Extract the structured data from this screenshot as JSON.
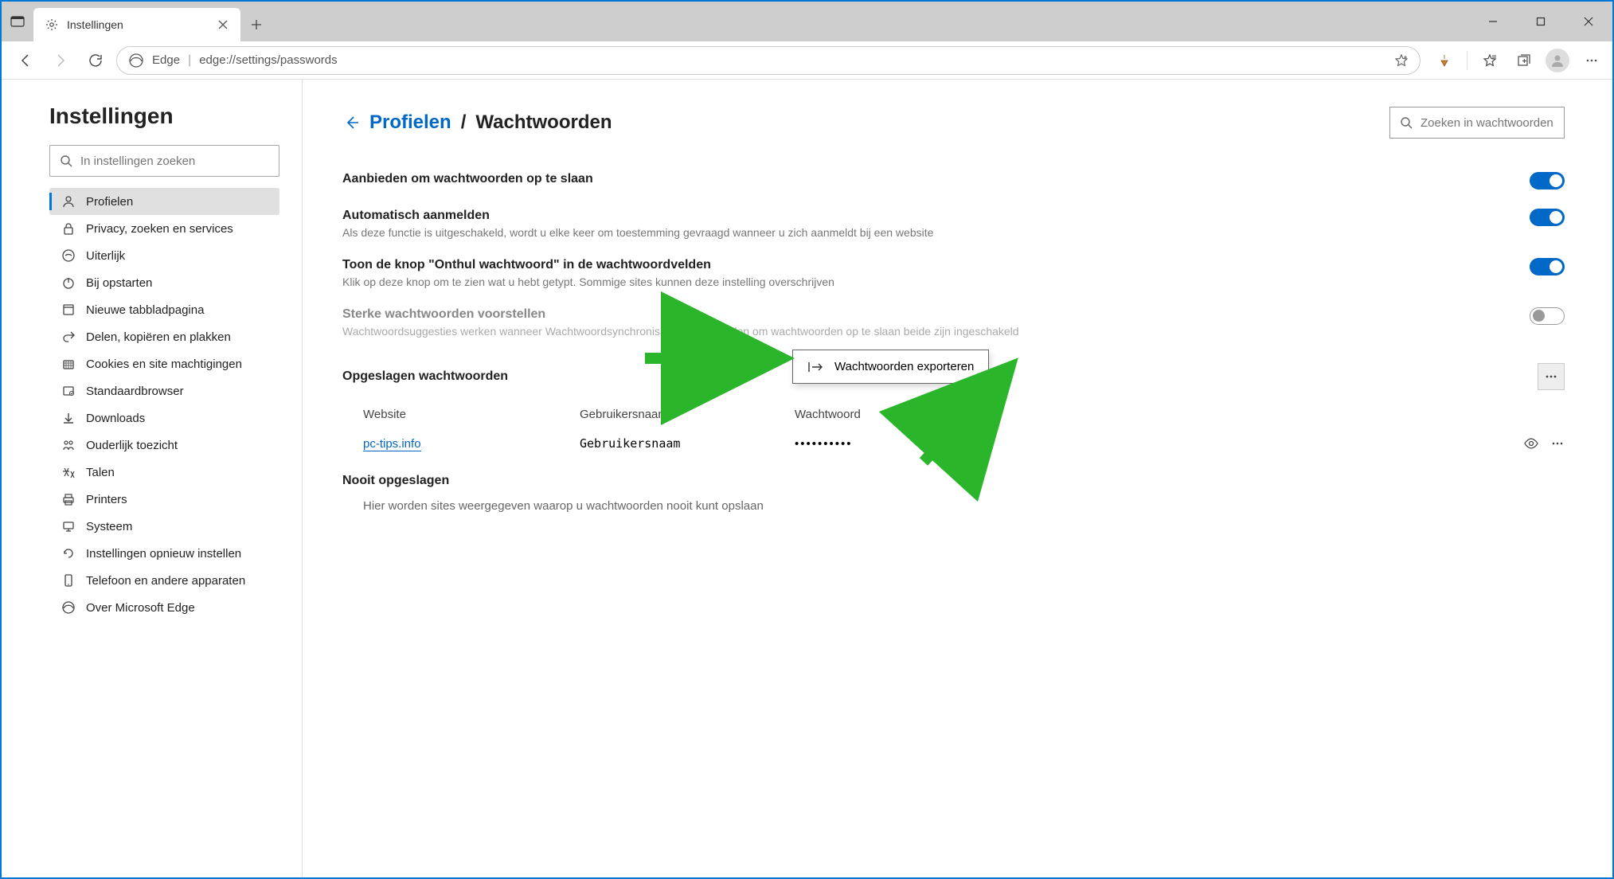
{
  "window": {
    "tab_title": "Instellingen",
    "address_label": "Edge",
    "address_url": "edge://settings/passwords"
  },
  "sidebar": {
    "title": "Instellingen",
    "search_placeholder": "In instellingen zoeken",
    "items": [
      {
        "label": "Profielen",
        "icon": "profile-icon",
        "active": true
      },
      {
        "label": "Privacy, zoeken en services",
        "icon": "lock-icon"
      },
      {
        "label": "Uiterlijk",
        "icon": "appearance-icon"
      },
      {
        "label": "Bij opstarten",
        "icon": "power-icon"
      },
      {
        "label": "Nieuwe tabbladpagina",
        "icon": "newtab-icon"
      },
      {
        "label": "Delen, kopiëren en plakken",
        "icon": "share-icon"
      },
      {
        "label": "Cookies en site machtigingen",
        "icon": "cookie-icon"
      },
      {
        "label": "Standaardbrowser",
        "icon": "default-icon"
      },
      {
        "label": "Downloads",
        "icon": "download-icon"
      },
      {
        "label": "Ouderlijk toezicht",
        "icon": "family-icon"
      },
      {
        "label": "Talen",
        "icon": "language-icon"
      },
      {
        "label": "Printers",
        "icon": "printer-icon"
      },
      {
        "label": "Systeem",
        "icon": "system-icon"
      },
      {
        "label": "Instellingen opnieuw instellen",
        "icon": "reset-icon"
      },
      {
        "label": "Telefoon en andere apparaten",
        "icon": "phone-icon"
      },
      {
        "label": "Over Microsoft Edge",
        "icon": "edge-icon"
      }
    ]
  },
  "main": {
    "breadcrumb_link": "Profielen",
    "breadcrumb_current": "Wachtwoorden",
    "search_placeholder": "Zoeken in wachtwoorden",
    "settings": [
      {
        "title": "Aanbieden om wachtwoorden op te slaan",
        "desc": "",
        "on": true
      },
      {
        "title": "Automatisch aanmelden",
        "desc": "Als deze functie is uitgeschakeld, wordt u elke keer om toestemming gevraagd wanneer u zich aanmeldt bij een website",
        "on": true
      },
      {
        "title": "Toon de knop \"Onthul wachtwoord\" in de wachtwoordvelden",
        "desc": "Klik op deze knop om te zien wat u hebt getypt. Sommige sites kunnen deze instelling overschrijven",
        "on": true
      },
      {
        "title": "Sterke wachtwoorden voorstellen",
        "desc": "Wachtwoordsuggesties werken wanneer Wachtwoordsynchronisatie en Aanbieden om wachtwoorden op te slaan beide zijn ingeschakeld",
        "on": false,
        "muted": true
      }
    ],
    "saved_section_title": "Opgeslagen wachtwoorden",
    "export_label": "Wachtwoorden exporteren",
    "columns": {
      "website": "Website",
      "username": "Gebruikersnaam",
      "password": "Wachtwoord"
    },
    "rows": [
      {
        "site": "pc-tips.info",
        "user": "Gebruikersnaam",
        "pass": "••••••••••"
      }
    ],
    "never_title": "Nooit opgeslagen",
    "never_desc": "Hier worden sites weergegeven waarop u wachtwoorden nooit kunt opslaan"
  }
}
